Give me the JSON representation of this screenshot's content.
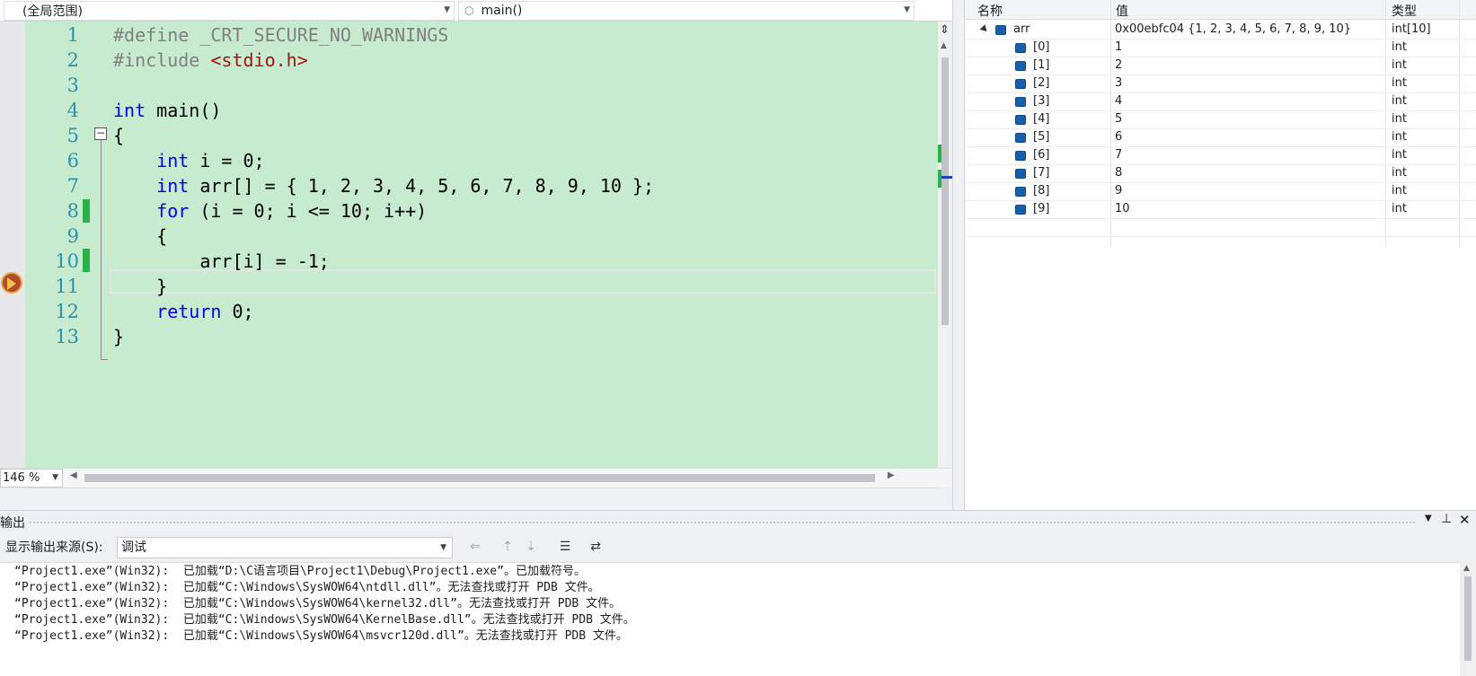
{
  "navbar": {
    "scope": "(全局范围)",
    "function": "main()"
  },
  "editor": {
    "line_numbers": [
      "1",
      "2",
      "3",
      "4",
      "5",
      "6",
      "7",
      "8",
      "9",
      "10",
      "11",
      "12",
      "13"
    ],
    "lines": [
      {
        "parts": [
          {
            "t": "#define _CRT_SECURE_NO_WARNINGS",
            "c": "pp"
          }
        ]
      },
      {
        "parts": [
          {
            "t": "#include ",
            "c": "pp"
          },
          {
            "t": "<stdio.h>",
            "c": "str"
          }
        ]
      },
      {
        "parts": []
      },
      {
        "parts": [
          {
            "t": "int",
            "c": "kw"
          },
          {
            "t": " main()",
            "c": ""
          }
        ]
      },
      {
        "parts": [
          {
            "t": "{",
            "c": ""
          }
        ]
      },
      {
        "parts": [
          {
            "t": "    ",
            "c": ""
          },
          {
            "t": "int",
            "c": "kw"
          },
          {
            "t": " i = 0;",
            "c": ""
          }
        ]
      },
      {
        "parts": [
          {
            "t": "    ",
            "c": ""
          },
          {
            "t": "int",
            "c": "kw"
          },
          {
            "t": " arr[] = { 1, 2, 3, 4, 5, 6, 7, 8, 9, 10 };",
            "c": ""
          }
        ]
      },
      {
        "parts": [
          {
            "t": "    ",
            "c": ""
          },
          {
            "t": "for",
            "c": "kw"
          },
          {
            "t": " (i = 0; i <= 10; i++)",
            "c": ""
          }
        ]
      },
      {
        "parts": [
          {
            "t": "    {",
            "c": ""
          }
        ]
      },
      {
        "parts": [
          {
            "t": "        arr[i] = -1;",
            "c": ""
          }
        ]
      },
      {
        "parts": [
          {
            "t": "    }",
            "c": ""
          }
        ]
      },
      {
        "parts": [
          {
            "t": "    ",
            "c": ""
          },
          {
            "t": "return",
            "c": "kw"
          },
          {
            "t": " 0;",
            "c": ""
          }
        ]
      },
      {
        "parts": [
          {
            "t": "}",
            "c": ""
          }
        ]
      }
    ],
    "zoom": "146 %"
  },
  "watch": {
    "col_name": "名称",
    "col_value": "值",
    "col_type": "类型",
    "root": {
      "name": "arr",
      "value": "0x00ebfc04 {1, 2, 3, 4, 5, 6, 7, 8, 9, 10}",
      "type": "int[10]"
    },
    "items": [
      {
        "name": "[0]",
        "value": "1",
        "type": "int"
      },
      {
        "name": "[1]",
        "value": "2",
        "type": "int"
      },
      {
        "name": "[2]",
        "value": "3",
        "type": "int"
      },
      {
        "name": "[3]",
        "value": "4",
        "type": "int"
      },
      {
        "name": "[4]",
        "value": "5",
        "type": "int"
      },
      {
        "name": "[5]",
        "value": "6",
        "type": "int"
      },
      {
        "name": "[6]",
        "value": "7",
        "type": "int"
      },
      {
        "name": "[7]",
        "value": "8",
        "type": "int"
      },
      {
        "name": "[8]",
        "value": "9",
        "type": "int"
      },
      {
        "name": "[9]",
        "value": "10",
        "type": "int"
      }
    ]
  },
  "output": {
    "title": "输出",
    "source_label": "显示输出来源(S):",
    "source_value": "调试",
    "lines": [
      "“Project1.exe”(Win32):  已加载“D:\\C语言项目\\Project1\\Debug\\Project1.exe”。已加载符号。",
      "“Project1.exe”(Win32):  已加载“C:\\Windows\\SysWOW64\\ntdll.dll”。无法查找或打开 PDB 文件。",
      "“Project1.exe”(Win32):  已加载“C:\\Windows\\SysWOW64\\kernel32.dll”。无法查找或打开 PDB 文件。",
      "“Project1.exe”(Win32):  已加载“C:\\Windows\\SysWOW64\\KernelBase.dll”。无法查找或打开 PDB 文件。",
      "“Project1.exe”(Win32):  已加载“C:\\Windows\\SysWOW64\\msvcr120d.dll”。无法查找或打开 PDB 文件。"
    ]
  }
}
